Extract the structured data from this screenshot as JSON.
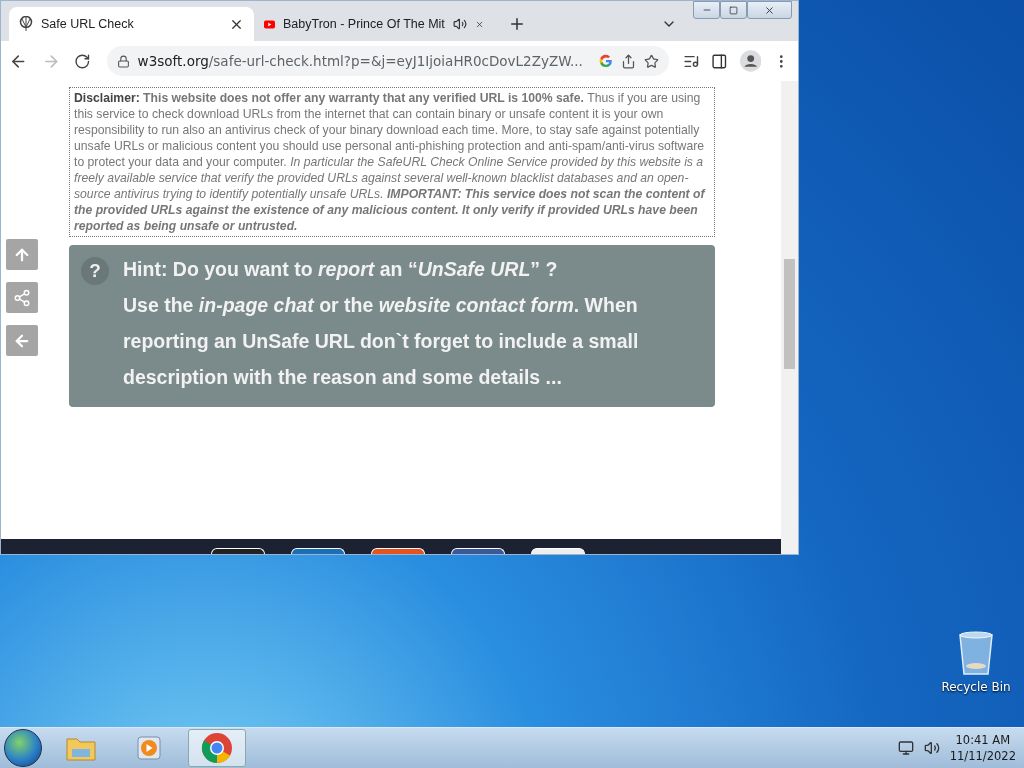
{
  "browser": {
    "tabs": [
      {
        "kind": "site",
        "title": "Safe URL Check",
        "selected": true,
        "playing_audio": false
      },
      {
        "kind": "video",
        "title": "BabyTron - Prince Of The Mit",
        "selected": false,
        "playing_audio": true
      }
    ],
    "address": {
      "url_host": "w3soft.org",
      "url_path": "/safe-url-check.html?p=&j=eyJ1IjoiaHR0cDovL2ZyZW..."
    },
    "page": {
      "disclaimer": [
        {
          "kind": "label",
          "text": "Disclaimer: "
        },
        {
          "kind": "bold",
          "text": "This website does not offer any warranty that any verified URL is 100% safe. "
        },
        {
          "kind": "plain",
          "text": "Thus if you are using this service to check download URLs from the internet that can contain binary or unsafe content it is your own responsibility to run also an antivirus check of your binary download each time. More, to stay safe against potentially unsafe URLs or malicious content you should use personal anti-phishing protection and anti-spam/anti-virus software to protect your data and your computer. "
        },
        {
          "kind": "italic",
          "text": "In particular the SafeURL Check Online Service provided by this website is a freely available service that verify the provided URLs against several well-known blacklist databases and an open-source antivirus trying to identify potentially unsafe URLs. "
        },
        {
          "kind": "bold-italic",
          "text": "IMPORTANT: This service does not scan the content of the provided URLs against the existence of any malicious content. It only verify if provided URLs have been reported as being unsafe or untrusted."
        }
      ],
      "hint": {
        "mark": "?",
        "lines": [
          "Hint: Do you want to *report* an “*UnSafe URL*” ?",
          "Use the *in-page chat* or the *website contact form*. When reporting an UnSafe URL don`t forget to include a small description with the reason and some details ..."
        ]
      },
      "side_buttons": [
        {
          "kind": "up"
        },
        {
          "kind": "share"
        },
        {
          "kind": "back"
        }
      ]
    }
  },
  "desktop": {
    "icons": [
      {
        "label": "Recycle Bin"
      }
    ]
  },
  "taskbar": {
    "apps": [
      {
        "kind": "explorer",
        "selected": false
      },
      {
        "kind": "media",
        "selected": false
      },
      {
        "kind": "chrome",
        "selected": true
      }
    ],
    "time": "10:41 AM",
    "date": "11/11/2022"
  }
}
